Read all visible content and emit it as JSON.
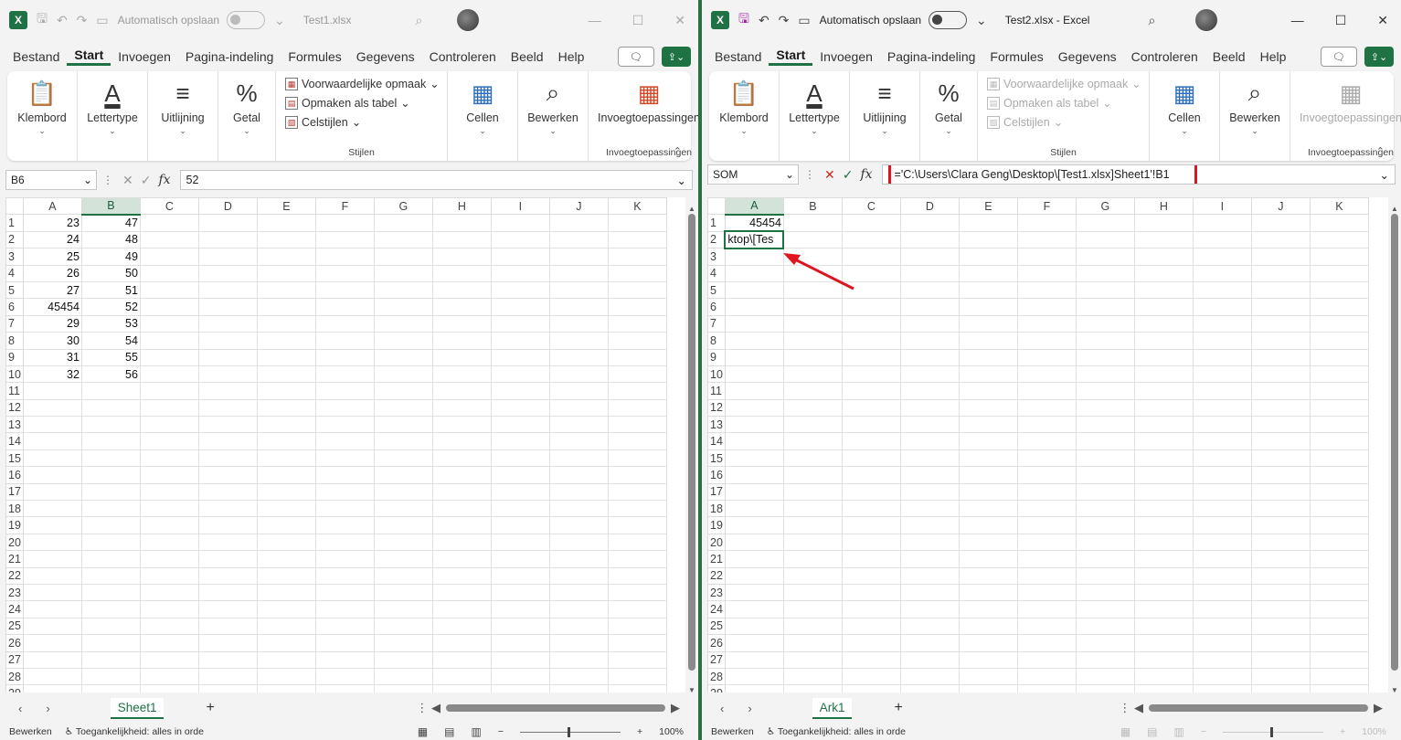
{
  "left": {
    "title": "Test1.xlsx",
    "autosave_label": "Automatisch opslaan",
    "menu": [
      "Bestand",
      "Start",
      "Invoegen",
      "Pagina-indeling",
      "Formules",
      "Gegevens",
      "Controleren",
      "Beeld",
      "Help"
    ],
    "ribbon": {
      "klembord": "Klembord",
      "lettertype": "Lettertype",
      "uitlijning": "Uitlijning",
      "getal": "Getal",
      "vw_opmaak": "Voorwaardelijke opmaak",
      "opmaken_tabel": "Opmaken als tabel",
      "celstijlen": "Celstijlen",
      "stijlen": "Stijlen",
      "cellen": "Cellen",
      "bewerken": "Bewerken",
      "invoeg_btn": "Invoegtoepassingen",
      "invoeg_group": "Invoegtoepassingen"
    },
    "namebox": "B6",
    "formula": "52",
    "columns": [
      "A",
      "B",
      "C",
      "D",
      "E",
      "F",
      "G",
      "H",
      "I",
      "J",
      "K"
    ],
    "rows": [
      [
        "23",
        "47"
      ],
      [
        "24",
        "48"
      ],
      [
        "25",
        "49"
      ],
      [
        "26",
        "50"
      ],
      [
        "27",
        "51"
      ],
      [
        "45454",
        "52"
      ],
      [
        "29",
        "53"
      ],
      [
        "30",
        "54"
      ],
      [
        "31",
        "55"
      ],
      [
        "32",
        "56"
      ]
    ],
    "sheet_tab": "Sheet1",
    "status_mode": "Bewerken",
    "status_access": "Toegankelijkheid: alles in orde",
    "zoom": "100%"
  },
  "right": {
    "title": "Test2.xlsx  -  Excel",
    "autosave_label": "Automatisch opslaan",
    "menu": [
      "Bestand",
      "Start",
      "Invoegen",
      "Pagina-indeling",
      "Formules",
      "Gegevens",
      "Controleren",
      "Beeld",
      "Help"
    ],
    "ribbon": {
      "klembord": "Klembord",
      "lettertype": "Lettertype",
      "uitlijning": "Uitlijning",
      "getal": "Getal",
      "vw_opmaak": "Voorwaardelijke opmaak",
      "opmaken_tabel": "Opmaken als tabel",
      "celstijlen": "Celstijlen",
      "stijlen": "Stijlen",
      "cellen": "Cellen",
      "bewerken": "Bewerken",
      "invoeg_btn": "Invoegtoepassingen",
      "invoeg_group": "Invoegtoepassingen"
    },
    "namebox": "SOM",
    "formula": "='C:\\Users\\Clara Geng\\Desktop\\[Test1.xlsx]Sheet1'!B1",
    "columns": [
      "A",
      "B",
      "C",
      "D",
      "E",
      "F",
      "G",
      "H",
      "I",
      "J",
      "K"
    ],
    "rows": [
      [
        "45454"
      ],
      [
        "ktop\\[Tes"
      ]
    ],
    "sheet_tab": "Ark1",
    "status_mode": "Bewerken",
    "status_access": "Toegankelijkheid: alles in orde",
    "zoom": "100%"
  },
  "row_numbers": [
    "1",
    "2",
    "3",
    "4",
    "5",
    "6",
    "7",
    "8",
    "9",
    "10",
    "11",
    "12",
    "13",
    "14",
    "15",
    "16",
    "17",
    "18",
    "19",
    "20",
    "21",
    "22",
    "23",
    "24",
    "25",
    "26",
    "27",
    "28",
    "29"
  ],
  "colors": {
    "excel_green": "#1f7244",
    "highlight_red": "#e0141e"
  }
}
